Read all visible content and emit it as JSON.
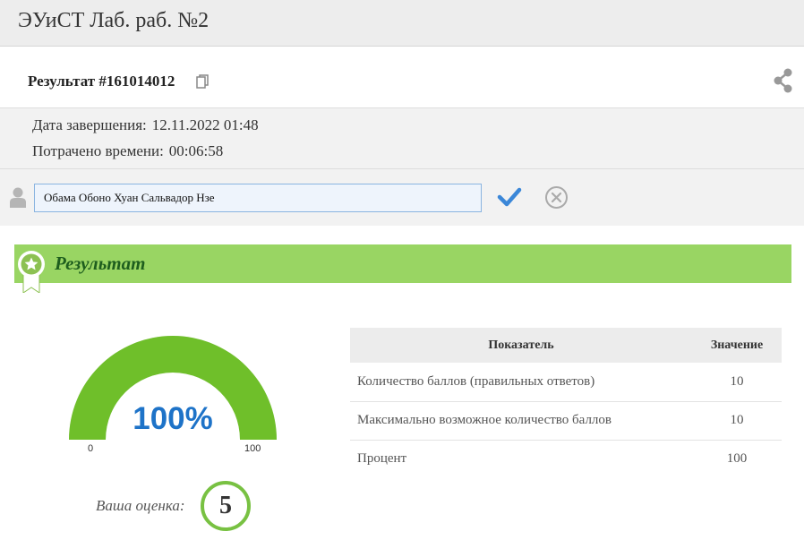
{
  "app": {
    "title": "ЭУиСТ Лаб. раб. №2"
  },
  "result": {
    "title": "Результат #161014012"
  },
  "meta": {
    "completion_label": "Дата завершения:",
    "completion_value": "12.11.2022 01:48",
    "time_label": "Потрачено времени:",
    "time_value": "00:06:58"
  },
  "user": {
    "name": "Обама Обоно Хуан Сальвадор Нзе"
  },
  "section": {
    "title": "Результат"
  },
  "gauge": {
    "value_text": "100%",
    "value": 100,
    "min": "0",
    "max": "100"
  },
  "grade": {
    "label": "Ваша оценка:",
    "value": "5"
  },
  "table": {
    "headers": [
      "Показатель",
      "Значение"
    ],
    "rows": [
      {
        "name": "Количество баллов (правильных ответов)",
        "value": "10"
      },
      {
        "name": "Максимально возможное количество баллов",
        "value": "10"
      },
      {
        "name": "Процент",
        "value": "100"
      }
    ]
  },
  "colors": {
    "accent_green": "#99d563",
    "gauge_green": "#6fbf2a",
    "value_blue": "#1e73c8",
    "check_blue": "#3b87d8"
  },
  "icons": [
    "copy-icon",
    "share-icon",
    "user-icon",
    "check-icon",
    "cancel-icon",
    "award-badge-icon"
  ]
}
